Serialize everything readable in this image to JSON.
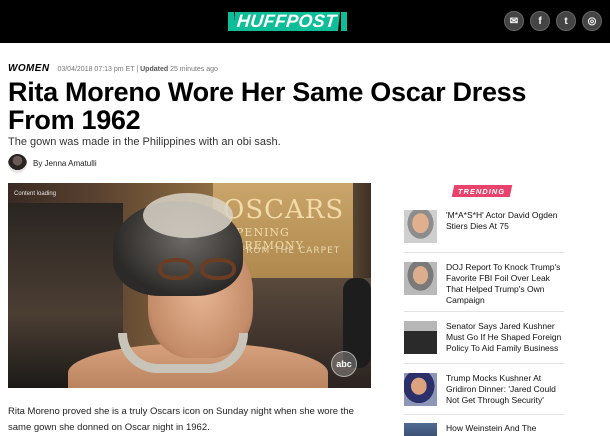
{
  "header": {
    "logo_text": "HUFFPOST",
    "social": [
      {
        "icon": "email-icon",
        "glyph": "✉"
      },
      {
        "icon": "facebook-icon",
        "glyph": "f"
      },
      {
        "icon": "twitter-icon",
        "glyph": "t"
      },
      {
        "icon": "instagram-icon",
        "glyph": "◎"
      }
    ],
    "brand_color": "#0dbe98"
  },
  "article": {
    "section": "WOMEN",
    "published": "03/04/2018 07:13 pm ET",
    "updated_label": "Updated",
    "updated_value": "25 minutes ago",
    "headline": "Rita Moreno Wore Her Same Oscar Dress From 1962",
    "subhead": "The gown was made in the Philippines with an obi sash.",
    "byline": "By Jenna Amatulli",
    "video_status": "Content loading",
    "video_overlay": {
      "board_title": "OSCARS",
      "board_subtitle": "OPENING CEREMONY",
      "carpet_text": "FROM THE CARPET",
      "network": "abc"
    },
    "body": "Rita Moreno proved she is a truly Oscars icon on Sunday night when she wore the same gown she donned on Oscar night in 1962."
  },
  "trending": {
    "label": "TRENDING",
    "accent_color": "#e9426c",
    "items": [
      {
        "title": "'M*A*S*H' Actor David Ogden Stiers Dies At 75"
      },
      {
        "title": "DOJ Report To Knock Trump's Favorite FBI Foil Over Leak That Helped Trump's Own Campaign"
      },
      {
        "title": "Senator Says Jared Kushner Must Go If He Shaped Foreign Policy To Aid Family Business"
      },
      {
        "title": "Trump Mocks Kushner At Gridiron Dinner: 'Jared Could Not Get Through Security'"
      },
      {
        "title": "How Weinstein And The"
      }
    ]
  }
}
